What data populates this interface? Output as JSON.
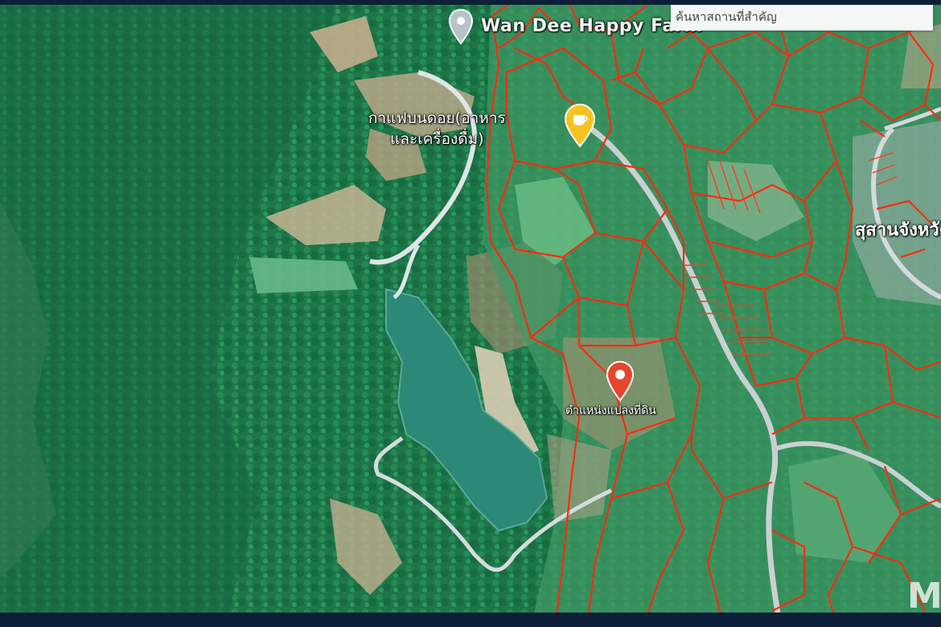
{
  "search": {
    "placeholder": "ค้นหาสถานที่สำคัญ"
  },
  "labels": {
    "place_top": "Wan Dee Happy Farm",
    "cafe_line1": "กาแฟบนดอย(อาหาร",
    "cafe_line2": "และเครื่องดื่ม)",
    "plot": "ตำแหน่งแปลงที่ดิน",
    "area_right": "สุสานจังหวัด"
  },
  "icons": {
    "place": "grey-location-pin-icon",
    "cafe": "yellow-cafe-pin-icon",
    "plot": "red-location-pin-icon",
    "brand": "brand-logo-watermark-icon"
  },
  "colors": {
    "forest": "#1f7a4a",
    "forest_dark": "#13573a",
    "water": "#2c8a78",
    "field": "#4aa36d",
    "bare": "#c9b99a",
    "road": "#e4e8ea",
    "parcel_line": "#ff2a10",
    "pin_red": "#e8452c",
    "pin_yellow": "#f6c221",
    "pin_grey": "#b7c2c9"
  },
  "watermark": {
    "text": "M"
  }
}
